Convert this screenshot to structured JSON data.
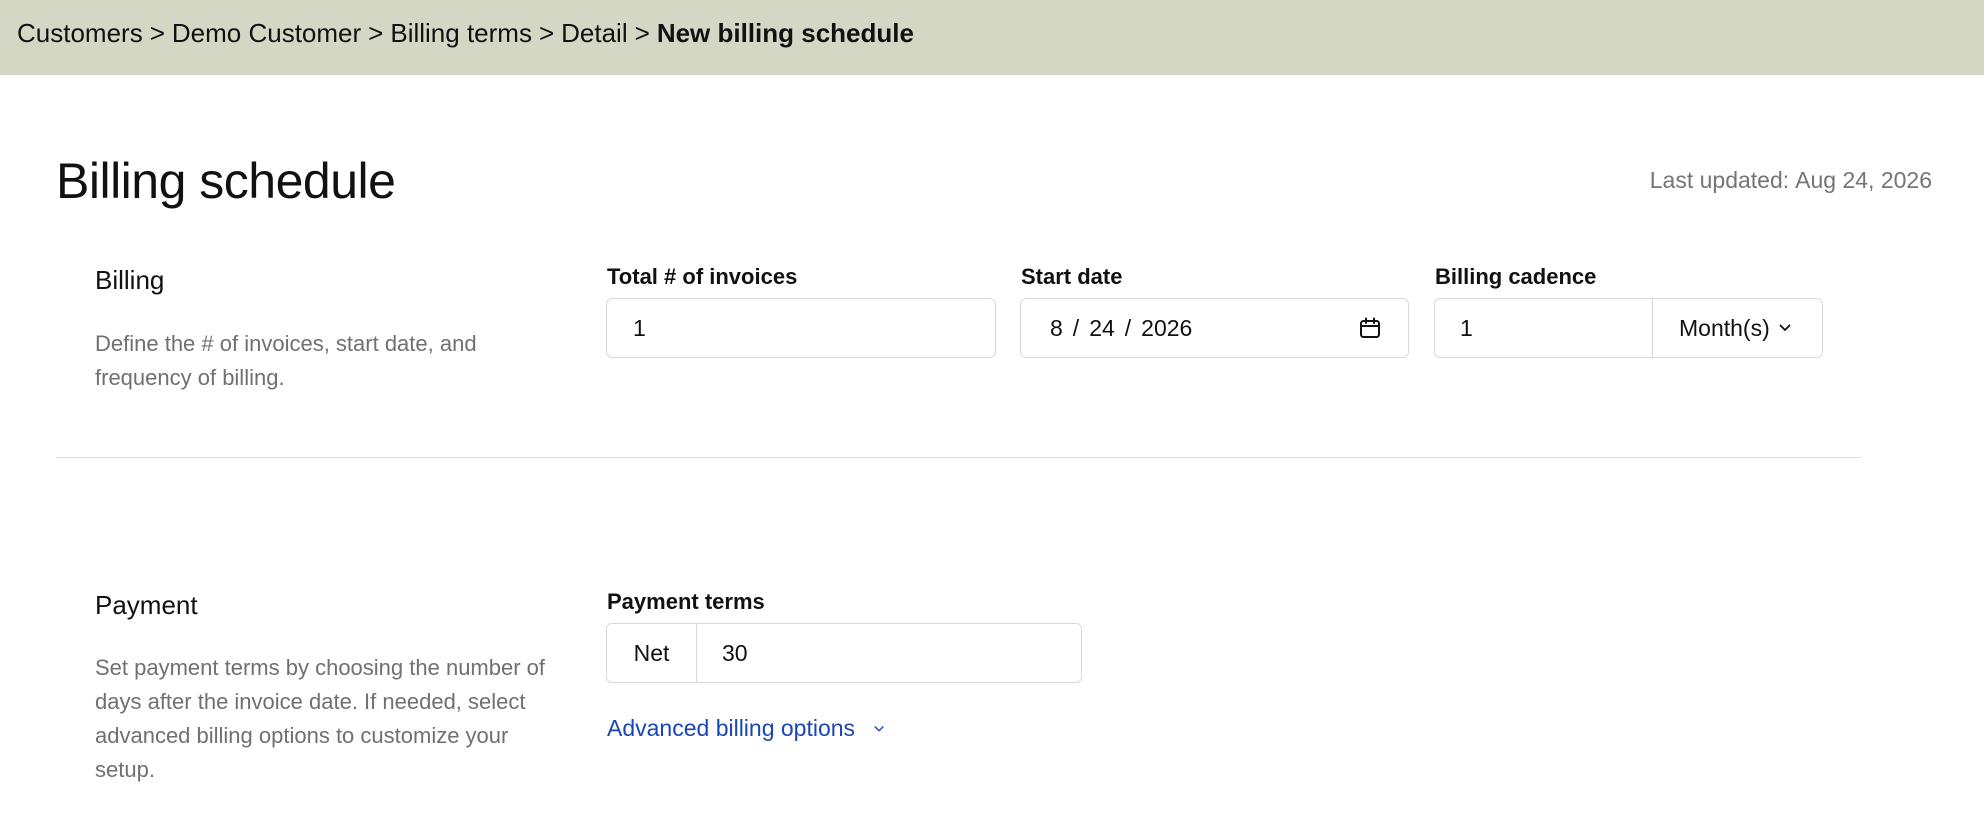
{
  "breadcrumb": {
    "items": [
      "Customers",
      "Demo Customer",
      "Billing terms",
      "Detail"
    ],
    "separator": ">",
    "current": "New billing schedule"
  },
  "page": {
    "title": "Billing schedule",
    "last_updated_label": "Last updated:",
    "last_updated_value": "Aug 24, 2026"
  },
  "billing": {
    "title": "Billing",
    "description": "Define the # of invoices, start date, and frequency of billing.",
    "total_invoices": {
      "label": "Total # of invoices",
      "value": "1"
    },
    "start_date": {
      "label": "Start date",
      "month": "8",
      "sep": "/",
      "day": "24",
      "year": "2026"
    },
    "cadence": {
      "label": "Billing cadence",
      "value": "1",
      "unit": "Month(s)"
    }
  },
  "payment": {
    "title": "Payment",
    "description": "Set payment terms by choosing the number of days after the invoice date. If needed, select advanced billing options to customize your setup.",
    "terms": {
      "label": "Payment terms",
      "prefix": "Net",
      "value": "30"
    },
    "advanced_link": "Advanced billing options"
  },
  "colors": {
    "topbar_bg": "#d3d7c4",
    "link": "#1a45b8",
    "muted_text": "#707070",
    "border": "#d9d9d9"
  },
  "icons": [
    "calendar-icon",
    "chevron-down-icon"
  ]
}
